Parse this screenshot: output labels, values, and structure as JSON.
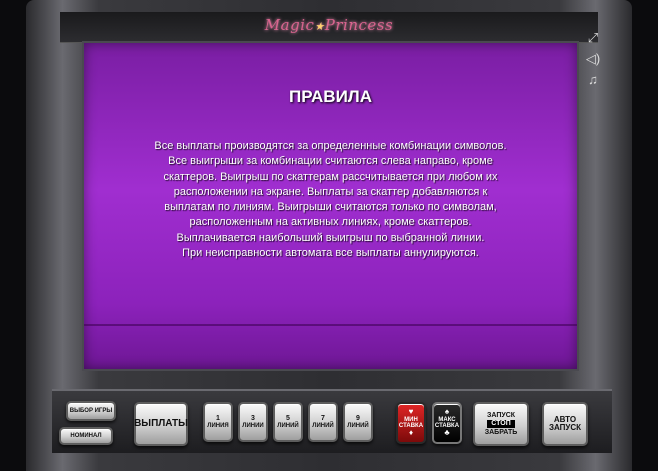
{
  "logo": {
    "text_before": "Magic",
    "text_after": "Princess",
    "star": "★"
  },
  "screen": {
    "title": "ПРАВИЛА",
    "body_lines": [
      "Все выплаты производятся за определенные комбинации символов.",
      "Все выигрыши за комбинации считаются слева направо, кроме",
      "скаттеров. Выигрыш по скаттерам рассчитывается при любом их",
      "расположении на экране. Выплаты за скаттер добавляются к",
      "выплатам по линиям. Выигрыши считаются только по символам,",
      "расположенным на активных линиях, кроме скаттеров.",
      "Выплачивается наибольший выигрыш по выбранной линии.",
      "При неисправности автомата все выплаты аннулируются."
    ]
  },
  "side_icons": [
    "fullscreen-icon",
    "sound-icon",
    "music-icon"
  ],
  "buttons": {
    "game_select": "ВЫБОР ИГРЫ",
    "denomination": "НОМИНАЛ",
    "payouts": "ВЫПЛАТЫ",
    "lines": [
      {
        "num": "1",
        "label": "ЛИНИЯ"
      },
      {
        "num": "3",
        "label": "ЛИНИИ"
      },
      {
        "num": "5",
        "label": "ЛИНИЙ"
      },
      {
        "num": "7",
        "label": "ЛИНИЙ"
      },
      {
        "num": "9",
        "label": "ЛИНИЙ"
      }
    ],
    "min_bet": {
      "line1": "МИН",
      "line2": "СТАВКА"
    },
    "max_bet": {
      "line1": "МАКС",
      "line2": "СТАВКА"
    },
    "start": {
      "top": "ЗАПУСК",
      "mid": "СТОП",
      "bottom": "ЗАБРАТЬ"
    },
    "auto": {
      "line1": "АВТО",
      "line2": "ЗАПУСК"
    }
  },
  "colors": {
    "screen": "#9a2bc9",
    "cabinet": "#2e2e32",
    "logo": "#d9648f"
  }
}
